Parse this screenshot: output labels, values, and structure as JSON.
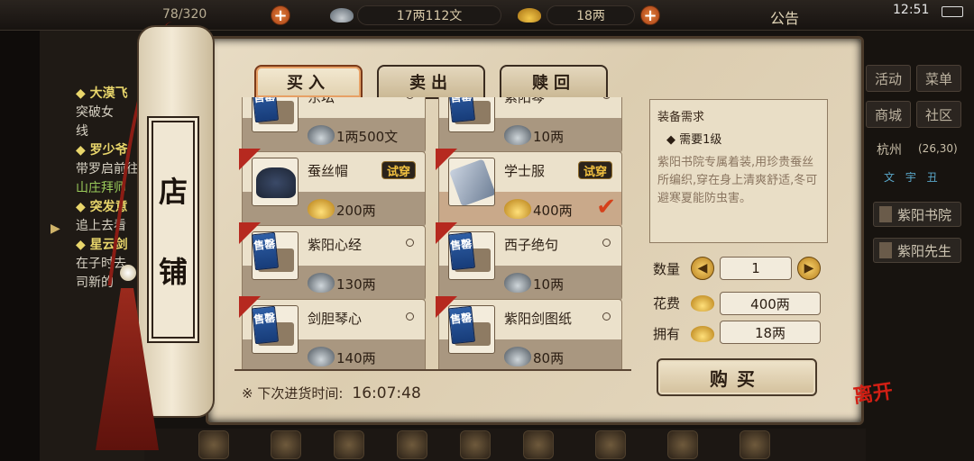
{
  "topbar": {
    "bag_count": "78/320",
    "money": "17两112文",
    "gold": "18两",
    "announcement": "公告",
    "time": "12:51",
    "plus_icon": "+"
  },
  "left_panel": {
    "quests": [
      {
        "text": "◆ 大漠飞",
        "style": "h"
      },
      {
        "text": "突破女",
        "style": ""
      },
      {
        "text": "线",
        "style": ""
      },
      {
        "text": "◆ 罗少爷",
        "style": "h"
      },
      {
        "text": "带罗启前往",
        "style": ""
      },
      {
        "text": "山庄拜师",
        "style": "g"
      },
      {
        "text": "◆ 突发意",
        "style": "h"
      },
      {
        "text": "追上去看",
        "style": ""
      },
      {
        "text": "◆ 星云剑",
        "style": "h"
      },
      {
        "text": "在子时去",
        "style": ""
      },
      {
        "text": "司新的",
        "style": ""
      }
    ]
  },
  "right_panel": {
    "buttons": [
      "活动",
      "菜单",
      "商城",
      "社区"
    ],
    "location": "杭州",
    "coords": "(26,30)",
    "mini": "文 宇 丑",
    "npcs": [
      "紫阳书院",
      "紫阳先生"
    ]
  },
  "shop": {
    "label_top": "店",
    "label_bottom": "铺",
    "tabs": [
      "买入",
      "卖出",
      "赎回"
    ],
    "sold_badge": "售罄",
    "try_label": "试穿",
    "items": [
      {
        "name": "东坛",
        "price": "1两500文",
        "currency": "silver",
        "sold_out": true,
        "try": false,
        "selected": false
      },
      {
        "name": "紫阳琴",
        "price": "10两",
        "currency": "silver",
        "sold_out": true,
        "try": false,
        "selected": false
      },
      {
        "name": "蚕丝帽",
        "price": "200两",
        "currency": "gold",
        "sold_out": false,
        "try": true,
        "selected": false,
        "art": "hat"
      },
      {
        "name": "学士服",
        "price": "400两",
        "currency": "gold",
        "sold_out": false,
        "try": true,
        "selected": true,
        "art": "robe"
      },
      {
        "name": "紫阳心经",
        "price": "130两",
        "currency": "silver",
        "sold_out": true,
        "try": false,
        "selected": false
      },
      {
        "name": "西子绝句",
        "price": "10两",
        "currency": "silver",
        "sold_out": true,
        "try": false,
        "selected": false
      },
      {
        "name": "剑胆琴心",
        "price": "140两",
        "currency": "silver",
        "sold_out": true,
        "try": false,
        "selected": false
      },
      {
        "name": "紫阳剑图纸",
        "price": "80两",
        "currency": "silver",
        "sold_out": true,
        "try": false,
        "selected": false
      }
    ],
    "restock_label": "※ 下次进货时间:",
    "restock_time": "16:07:48"
  },
  "detail": {
    "req_title": "装备需求",
    "req_level": "◆ 需要1级",
    "description": "紫阳书院专属着装,用珍贵蚕丝所编织,穿在身上清爽舒适,冬可避寒夏能防虫害。",
    "qty_label": "数量",
    "qty": "1",
    "cost_label": "花费",
    "cost": "400两",
    "own_label": "拥有",
    "own": "18两",
    "buy_label": "购买",
    "leave_label": "离开"
  },
  "bottom": {
    "icons": [
      "equip-icon",
      "martial-icon",
      "item-icon",
      "skill-icon",
      "task-icon",
      "map-icon",
      "notes-icon",
      "bag-icon",
      "more-icon"
    ]
  }
}
